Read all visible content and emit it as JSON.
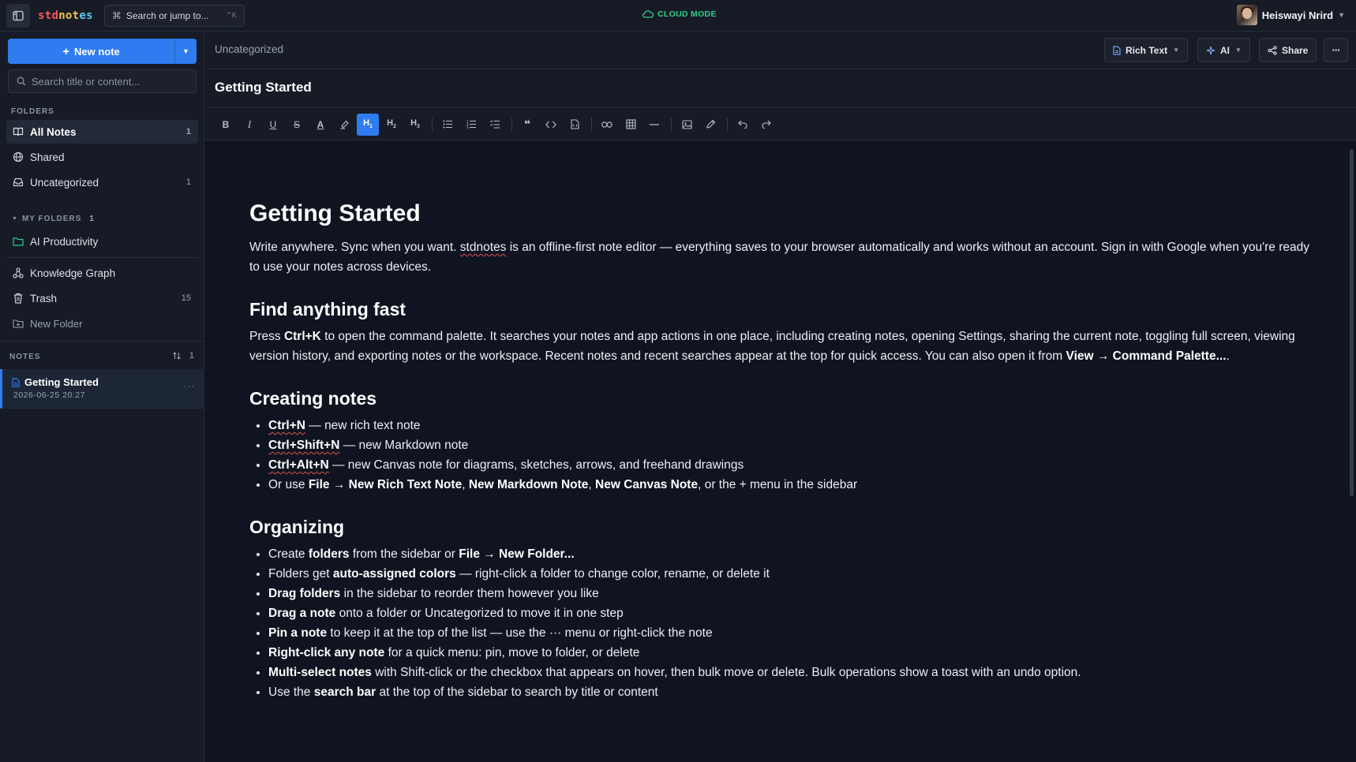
{
  "app": {
    "logo_parts": [
      "std",
      "not",
      "es"
    ],
    "jump_placeholder": "Search or jump to...",
    "jump_shortcut": "⌃K",
    "mode_label": "CLOUD MODE",
    "user_name": "Heiswayi Nrird"
  },
  "sidebar": {
    "new_note_label": "New note",
    "search_placeholder": "Search title or content...",
    "folders_label": "FOLDERS",
    "items": [
      {
        "label": "All Notes",
        "count": "1",
        "icon": "book-icon"
      },
      {
        "label": "Shared",
        "count": "",
        "icon": "globe-icon"
      },
      {
        "label": "Uncategorized",
        "count": "1",
        "icon": "inbox-icon"
      }
    ],
    "my_folders_label": "MY FOLDERS",
    "my_folders_count": "1",
    "folders": [
      {
        "label": "AI Productivity",
        "color": "#2fce8a"
      }
    ],
    "extra": [
      {
        "label": "Knowledge Graph",
        "count": ""
      },
      {
        "label": "Trash",
        "count": "15"
      },
      {
        "label": "New Folder",
        "count": ""
      }
    ],
    "notes_label": "NOTES",
    "notes_count": "1",
    "notes": [
      {
        "title": "Getting Started",
        "date": "2026-06-25 20:27"
      }
    ]
  },
  "header": {
    "breadcrumb": "Uncategorized",
    "mode_button": "Rich Text",
    "ai_button": "AI",
    "share_button": "Share",
    "note_title": "Getting Started"
  },
  "doc": {
    "h1": "Getting Started",
    "intro_a": "Write anywhere. Sync when you want. ",
    "intro_brand": "stdnotes",
    "intro_b": " is an offline-first note editor — everything saves to your browser automatically and works without an account. Sign in with Google when you're ready to use your notes across devices.",
    "h2_find": "Find anything fast",
    "find_a": "Press ",
    "find_key": "Ctrl+K",
    "find_b": " to open the command palette. It searches your notes and app actions in one place, including creating notes, opening Settings, sharing the current note, toggling full screen, viewing version history, and exporting notes or the workspace. Recent notes and recent searches appear at the top for quick access. You can also open it from ",
    "find_menu": "View → Command Palette...",
    "find_end": ".",
    "h2_create": "Creating notes",
    "create": [
      {
        "key": "Ctrl+N",
        "text": " — new rich text note"
      },
      {
        "key": "Ctrl+Shift+N",
        "text": " — new Markdown note"
      },
      {
        "key": "Ctrl+Alt+N",
        "text": " — new Canvas note for diagrams, sketches, arrows, and freehand drawings"
      }
    ],
    "create_last": {
      "a": "Or use ",
      "b1": "File → New Rich Text Note",
      "c1": ", ",
      "b2": "New Markdown Note",
      "c2": ", ",
      "b3": "New Canvas Note",
      "d": ", or the + menu in the sidebar"
    },
    "h2_org": "Organizing",
    "org": [
      {
        "a": "Create ",
        "b": "folders",
        "c": " from the sidebar or ",
        "d": "File → New Folder...",
        "e": ""
      },
      {
        "a": "Folders get ",
        "b": "auto-assigned colors",
        "c": " — right-click a folder to change color, rename, or delete it",
        "d": "",
        "e": ""
      },
      {
        "a": "",
        "b": "Drag folders",
        "c": " in the sidebar to reorder them however you like",
        "d": "",
        "e": ""
      },
      {
        "a": "",
        "b": "Drag a note",
        "c": " onto a folder or Uncategorized to move it in one step",
        "d": "",
        "e": ""
      },
      {
        "a": "",
        "b": "Pin a note",
        "c": " to keep it at the top of the list — use the ··· menu or right-click the note",
        "d": "",
        "e": ""
      },
      {
        "a": "",
        "b": "Right-click any note",
        "c": " for a quick menu: pin, move to folder, or delete",
        "d": "",
        "e": ""
      },
      {
        "a": "",
        "b": "Multi-select notes",
        "c": " with Shift-click or the checkbox that appears on hover, then bulk move or delete. Bulk operations show a toast with an undo option.",
        "d": "",
        "e": ""
      },
      {
        "a": "Use the ",
        "b": "search bar",
        "c": " at the top of the sidebar to search by title or content",
        "d": "",
        "e": ""
      }
    ]
  },
  "colors": {
    "accent": "#2f7cf0",
    "cloud": "#2fce8a",
    "background": "#0f1420",
    "panel": "#161b26"
  }
}
